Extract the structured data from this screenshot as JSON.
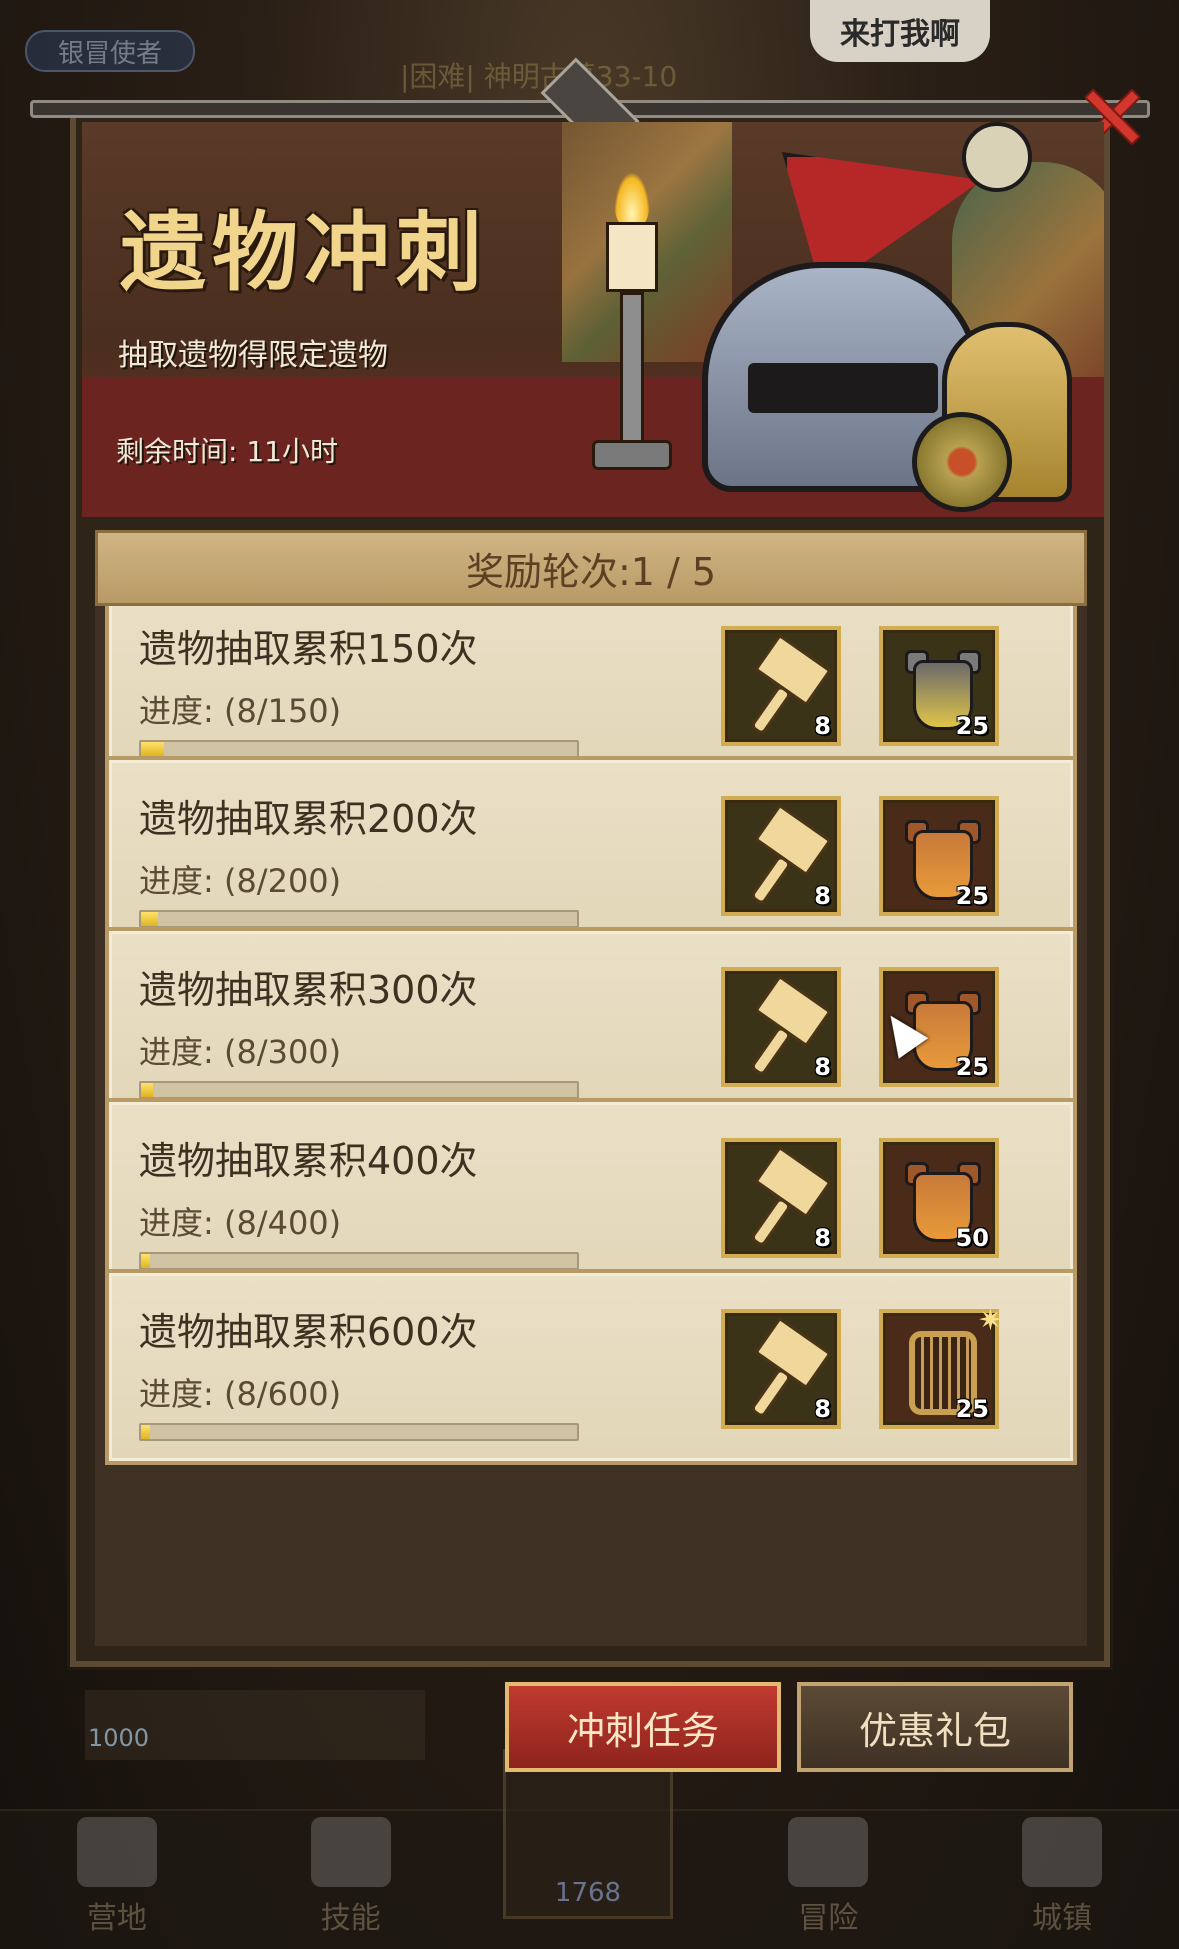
{
  "background": {
    "top_badge": "银冒使者",
    "level_label": "|困难| 神明古墓33-10",
    "speech_bubble": "来打我啊",
    "left_tile_value": "1000",
    "nav": {
      "items": [
        "营地",
        "技能",
        "冒险",
        "城镇"
      ],
      "center_value": "1768"
    }
  },
  "banner": {
    "title": "遗物冲刺",
    "subtitle": "抽取遗物得限定遗物",
    "time_left": "剩余时间: 11小时"
  },
  "round": {
    "label": "奖励轮次:1 / 5"
  },
  "tasks": [
    {
      "title": "遗物抽取累积150次",
      "progress_text": "进度: (8/150)",
      "progress": 0.053,
      "reward1_count": "8",
      "reward2_count": "25",
      "reward2_type": "gold-armor"
    },
    {
      "title": "遗物抽取累积200次",
      "progress_text": "进度: (8/200)",
      "progress": 0.04,
      "reward1_count": "8",
      "reward2_count": "25",
      "reward2_type": "orange-armor"
    },
    {
      "title": "遗物抽取累积300次",
      "progress_text": "进度: (8/300)",
      "progress": 0.027,
      "reward1_count": "8",
      "reward2_count": "25",
      "reward2_type": "orange-armor"
    },
    {
      "title": "遗物抽取累积400次",
      "progress_text": "进度: (8/400)",
      "progress": 0.02,
      "reward1_count": "8",
      "reward2_count": "50",
      "reward2_type": "orange-armor"
    },
    {
      "title": "遗物抽取累积600次",
      "progress_text": "进度: (8/600)",
      "progress": 0.013,
      "reward1_count": "8",
      "reward2_count": "25",
      "reward2_type": "harp"
    }
  ],
  "tabs": {
    "active": "冲刺任务",
    "inactive": "优惠礼包"
  },
  "colors": {
    "accent_red": "#c03a30",
    "progress_yellow": "#ffe26a",
    "card_bg": "#eae0c6",
    "title_gold": "#f2d58c"
  }
}
